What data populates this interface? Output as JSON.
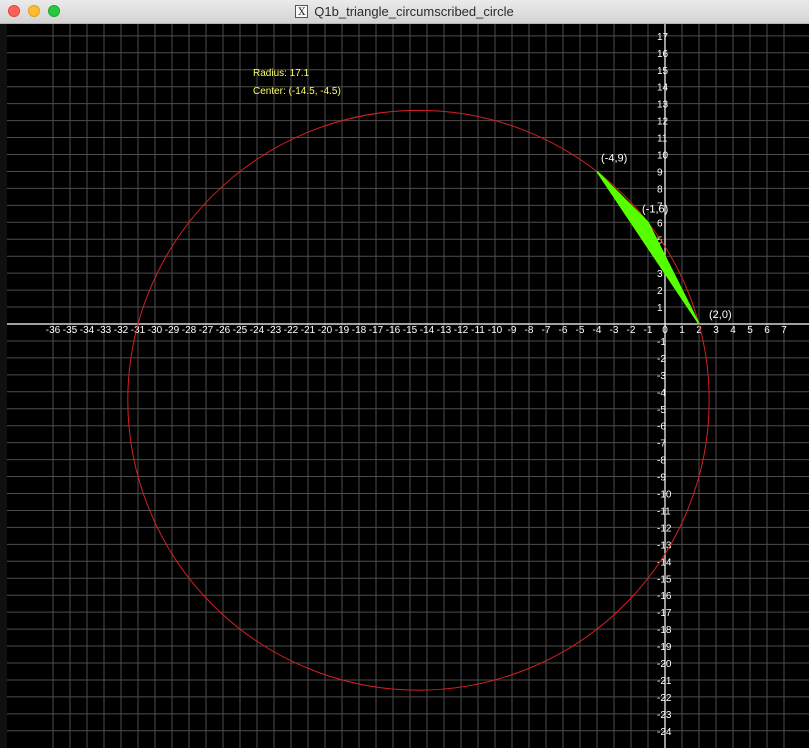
{
  "window": {
    "title": "Q1b_triangle_circumscribed_circle",
    "title_icon": "x11-icon"
  },
  "colors": {
    "background": "#000000",
    "grid": "#4d4d4d",
    "axis": "#ffffff",
    "circle": "#d42020",
    "triangle": "#55ff00",
    "info_text": "#ffff66",
    "label_text": "#ffffff"
  },
  "info": {
    "radius_text": "Radius: 17.1",
    "center_text": "Center: (-14.5, -4.5)"
  },
  "chart_data": {
    "type": "scatter",
    "xlim": [
      -36.5,
      7.7
    ],
    "ylim": [
      -24.5,
      17.7
    ],
    "grid": true,
    "x_ticks": [
      -36,
      -35,
      -34,
      -33,
      -32,
      -31,
      -30,
      -29,
      -28,
      -27,
      -26,
      -25,
      -24,
      -23,
      -22,
      -21,
      -20,
      -19,
      -18,
      -17,
      -16,
      -15,
      -14,
      -13,
      -12,
      -11,
      -10,
      -9,
      -8,
      -7,
      -6,
      -5,
      -4,
      -3,
      -2,
      -1,
      0,
      1,
      2,
      3,
      4,
      5,
      6,
      7
    ],
    "y_ticks": [
      17,
      16,
      15,
      14,
      13,
      12,
      11,
      10,
      9,
      8,
      7,
      6,
      5,
      4,
      3,
      2,
      1,
      -1,
      -2,
      -3,
      -4,
      -5,
      -6,
      -7,
      -8,
      -9,
      -10,
      -11,
      -12,
      -13,
      -14,
      -15,
      -16,
      -17,
      -18,
      -19,
      -20,
      -21,
      -22,
      -23,
      -24
    ],
    "circle": {
      "center": [
        -14.5,
        -4.5
      ],
      "radius": 17.1
    },
    "triangle": [
      [
        -4,
        9
      ],
      [
        -1,
        6
      ],
      [
        2,
        0
      ]
    ],
    "point_labels": [
      "(-4,9)",
      "(-1,6)",
      "(2,0)"
    ]
  }
}
